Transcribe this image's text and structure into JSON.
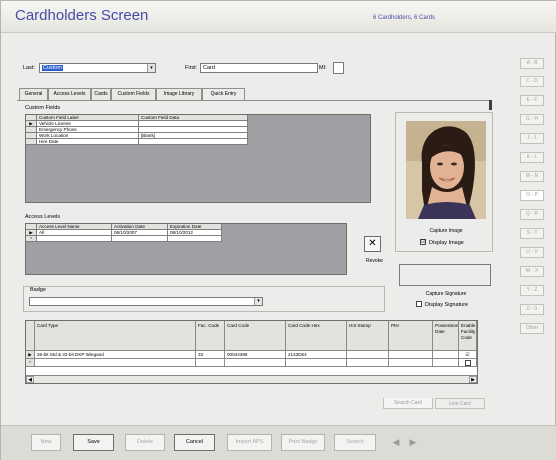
{
  "window": {
    "title": "Cardholders Screen",
    "count_text": "6 Cardholders, 6 Cards"
  },
  "name": {
    "last_label": "Last:",
    "last_value": "Custom",
    "first_label": "First:",
    "first_value": "Card",
    "mi_label": "MI:",
    "mi_value": ""
  },
  "tabs": [
    "General",
    "Access Levels",
    "Cards",
    "Custom Fields",
    "Image Library",
    "Quick Entry"
  ],
  "custom_fields": {
    "label": "Custom Fields",
    "headers": [
      "Custom Field Label",
      "Custom Field Data"
    ],
    "rows": [
      [
        "Vehicle License",
        ""
      ],
      [
        "Emergency Phone",
        ""
      ],
      [
        "Work Location",
        "[Blank]"
      ],
      [
        "Hire Date",
        ""
      ]
    ]
  },
  "access_levels": {
    "label": "Access Levels",
    "headers": [
      "Access Level Name",
      "Activation Date",
      "Expiration Date"
    ],
    "rows": [
      [
        "All",
        "08/10/2007",
        "08/10/2012"
      ]
    ],
    "new_row_marker": "*"
  },
  "revoke": {
    "icon_glyph": "✕",
    "label": "Revoke"
  },
  "badge": {
    "label": "Badge",
    "value": ""
  },
  "cards": {
    "headers": [
      "Card Type",
      "Fac. Code",
      "Card Code",
      "Card Code Hex",
      "Hot Stamp",
      "PIN",
      "Possession Date",
      "Enable Facility Code"
    ],
    "rows": [
      [
        "26-bit Std & 33-bit DKP Wiegand",
        "33",
        "00044388",
        "2143D64",
        "",
        "",
        "",
        "☑"
      ]
    ],
    "new_row_marker": "*",
    "scroll_left": "◀",
    "scroll_right": "▶"
  },
  "photo": {
    "capture_label": "Capture Image",
    "display_label": "Display Image",
    "display_checked": "☑"
  },
  "signature": {
    "capture_label": "Capture Signature",
    "display_label": "Display Signature",
    "display_checked": ""
  },
  "bottom_tabs": [
    "Search Card",
    "Live Card"
  ],
  "alpha_index": [
    "A - B",
    "C - D",
    "E - F",
    "G - H",
    "I - J",
    "K - L",
    "M - N",
    "O - P",
    "Q - R",
    "S - T",
    "U - V",
    "W - X",
    "Y - Z",
    "0 - 9",
    "Other"
  ],
  "footer": {
    "new": "New",
    "save": "Save",
    "delete": "Delete",
    "cancel": "Cancel",
    "import_aps": "Import APS",
    "print_badge": "Print Badge",
    "search": "Search",
    "prev": "◀",
    "next": "▶"
  },
  "colors": {
    "title_text": "#4a4aa6",
    "grid_background": "#9fa0a3",
    "selection": "#2f5ecb"
  }
}
